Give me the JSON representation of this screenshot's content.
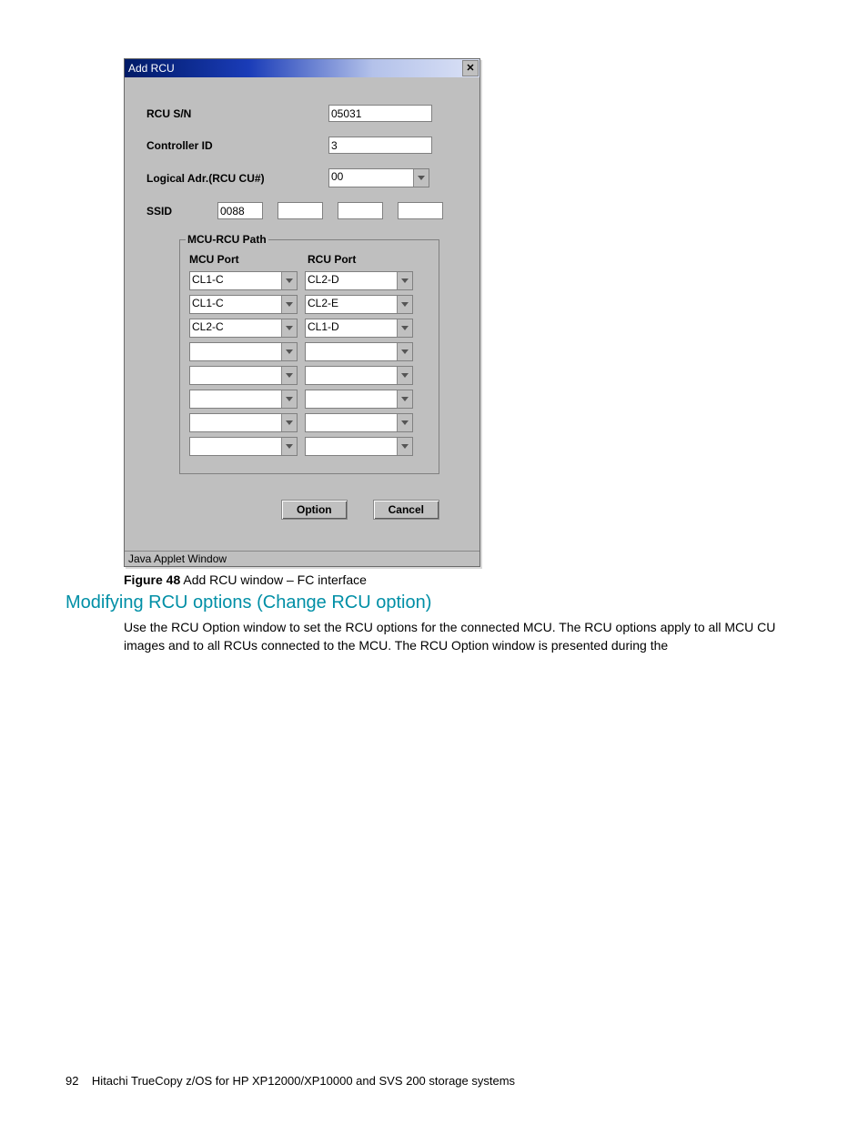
{
  "dialog": {
    "title": "Add RCU",
    "close_symbol": "✕",
    "fields": {
      "rcu_sn_label": "RCU S/N",
      "rcu_sn_value": "05031",
      "controller_id_label": "Controller ID",
      "controller_id_value": "3",
      "logical_adr_label": "Logical Adr.(RCU CU#)",
      "logical_adr_value": "00",
      "ssid_label": "SSID",
      "ssid_values": [
        "0088",
        "",
        "",
        ""
      ]
    },
    "path_group": {
      "legend": "MCU-RCU Path",
      "mcu_header": "MCU Port",
      "rcu_header": "RCU Port",
      "rows": [
        {
          "mcu": "CL1-C",
          "rcu": "CL2-D"
        },
        {
          "mcu": "CL1-C",
          "rcu": "CL2-E"
        },
        {
          "mcu": "CL2-C",
          "rcu": "CL1-D"
        },
        {
          "mcu": "",
          "rcu": ""
        },
        {
          "mcu": "",
          "rcu": ""
        },
        {
          "mcu": "",
          "rcu": ""
        },
        {
          "mcu": "",
          "rcu": ""
        },
        {
          "mcu": "",
          "rcu": ""
        }
      ]
    },
    "buttons": {
      "option": "Option",
      "cancel": "Cancel"
    },
    "statusbar": "Java Applet Window"
  },
  "caption": {
    "label": "Figure 48",
    "text": " Add RCU window – FC interface"
  },
  "heading": "Modifying RCU options (Change RCU option)",
  "paragraph": "Use the RCU Option window to set the RCU options for the connected MCU. The RCU options apply to all MCU CU images and to all RCUs connected to the MCU. The RCU Option window is presented during the",
  "footer": {
    "page_number": "92",
    "text": "Hitachi TrueCopy z/OS for HP XP12000/XP10000 and SVS 200 storage systems"
  }
}
